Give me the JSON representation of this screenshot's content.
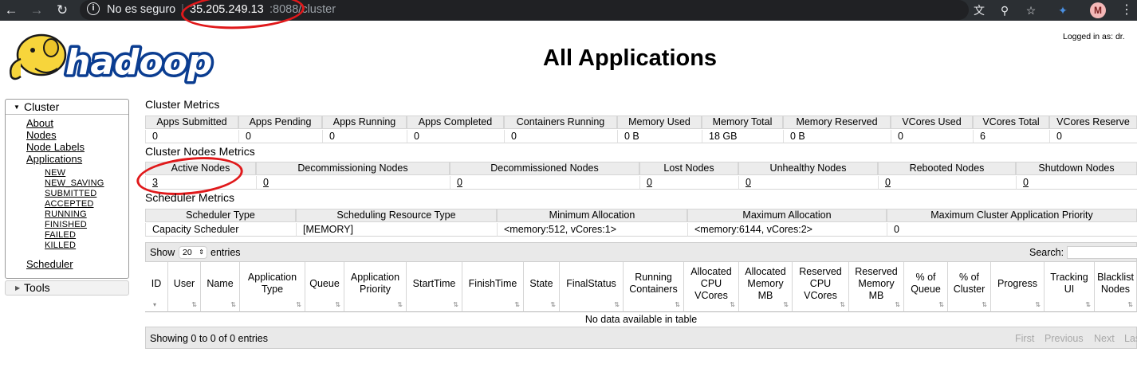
{
  "browser": {
    "security_label": "No es seguro",
    "url_host": "35.205.249.13",
    "url_path": ":8088/cluster",
    "avatar_letter": "M",
    "icons": [
      "back-icon",
      "forward-icon",
      "reload-icon",
      "info-icon",
      "translate-icon",
      "zoom-icon",
      "star-icon",
      "extension-icon",
      "menu-icon"
    ],
    "colors": {
      "chrome_bg": "#2b2f33",
      "omnibox_bg": "#202124",
      "annotation": "#e0191b"
    }
  },
  "header": {
    "logged_in": "Logged in as: dr.",
    "logo_text": "hadoop",
    "title": "All Applications"
  },
  "sidebar": {
    "cluster_label": "Cluster",
    "links": [
      "About",
      "Nodes",
      "Node Labels",
      "Applications"
    ],
    "app_states": [
      "NEW",
      "NEW_SAVING",
      "SUBMITTED",
      "ACCEPTED",
      "RUNNING",
      "FINISHED",
      "FAILED",
      "KILLED"
    ],
    "scheduler_label": "Scheduler",
    "tools_label": "Tools"
  },
  "cluster_metrics": {
    "title": "Cluster Metrics",
    "headers": [
      "Apps Submitted",
      "Apps Pending",
      "Apps Running",
      "Apps Completed",
      "Containers Running",
      "Memory Used",
      "Memory Total",
      "Memory Reserved",
      "VCores Used",
      "VCores Total",
      "VCores Reserve"
    ],
    "values": [
      "0",
      "0",
      "0",
      "0",
      "0",
      "0 B",
      "18 GB",
      "0 B",
      "0",
      "6",
      "0"
    ]
  },
  "node_metrics": {
    "title": "Cluster Nodes Metrics",
    "headers": [
      "Active Nodes",
      "Decommissioning Nodes",
      "Decommissioned Nodes",
      "Lost Nodes",
      "Unhealthy Nodes",
      "Rebooted Nodes",
      "Shutdown Nodes"
    ],
    "values": [
      "3",
      "0",
      "0",
      "0",
      "0",
      "0",
      "0"
    ]
  },
  "scheduler_metrics": {
    "title": "Scheduler Metrics",
    "headers": [
      "Scheduler Type",
      "Scheduling Resource Type",
      "Minimum Allocation",
      "Maximum Allocation",
      "Maximum Cluster Application Priority"
    ],
    "values": [
      "Capacity Scheduler",
      "[MEMORY]",
      "<memory:512, vCores:1>",
      "<memory:6144, vCores:2>",
      "0"
    ]
  },
  "apps_table": {
    "show_label": "Show",
    "entries_value": "20",
    "entries_label": "entries",
    "search_label": "Search:",
    "columns": [
      {
        "lines": [
          "ID"
        ]
      },
      {
        "lines": [
          "User"
        ]
      },
      {
        "lines": [
          "Name"
        ]
      },
      {
        "lines": [
          "Application",
          "Type"
        ]
      },
      {
        "lines": [
          "Queue"
        ]
      },
      {
        "lines": [
          "Application",
          "Priority"
        ]
      },
      {
        "lines": [
          "StartTime"
        ]
      },
      {
        "lines": [
          "FinishTime"
        ]
      },
      {
        "lines": [
          "State"
        ]
      },
      {
        "lines": [
          "FinalStatus"
        ]
      },
      {
        "lines": [
          "Running",
          "Containers"
        ]
      },
      {
        "lines": [
          "Allocated",
          "CPU",
          "VCores"
        ]
      },
      {
        "lines": [
          "Allocated",
          "Memory",
          "MB"
        ]
      },
      {
        "lines": [
          "Reserved",
          "CPU",
          "VCores"
        ]
      },
      {
        "lines": [
          "Reserved",
          "Memory",
          "MB"
        ]
      },
      {
        "lines": [
          "% of",
          "Queue"
        ]
      },
      {
        "lines": [
          "% of",
          "Cluster"
        ]
      },
      {
        "lines": [
          "Progress"
        ]
      },
      {
        "lines": [
          "Tracking",
          "UI"
        ]
      },
      {
        "lines": [
          "Blacklist",
          "Nodes"
        ]
      }
    ],
    "no_data": "No data available in table",
    "showing": "Showing 0 to 0 of 0 entries",
    "pagination": [
      "First",
      "Previous",
      "Next",
      "Las"
    ]
  }
}
